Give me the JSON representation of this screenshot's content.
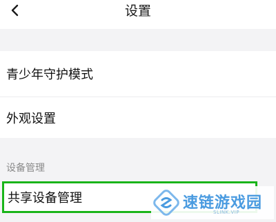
{
  "header": {
    "title": "设置",
    "back_icon": "chevron-left-icon"
  },
  "settings": {
    "items": [
      {
        "label": "青少年守护模式"
      },
      {
        "label": "外观设置"
      }
    ]
  },
  "device_section": {
    "title": "设备管理",
    "items": [
      {
        "label": "共享设备管理",
        "highlighted": true
      }
    ]
  },
  "watermark": {
    "name": "速链游戏园",
    "sub": "SLINK.VIP"
  },
  "colors": {
    "highlight_border": "#19b419",
    "section_bg": "#f3f3f5",
    "watermark_blue": "#4a9be0"
  }
}
